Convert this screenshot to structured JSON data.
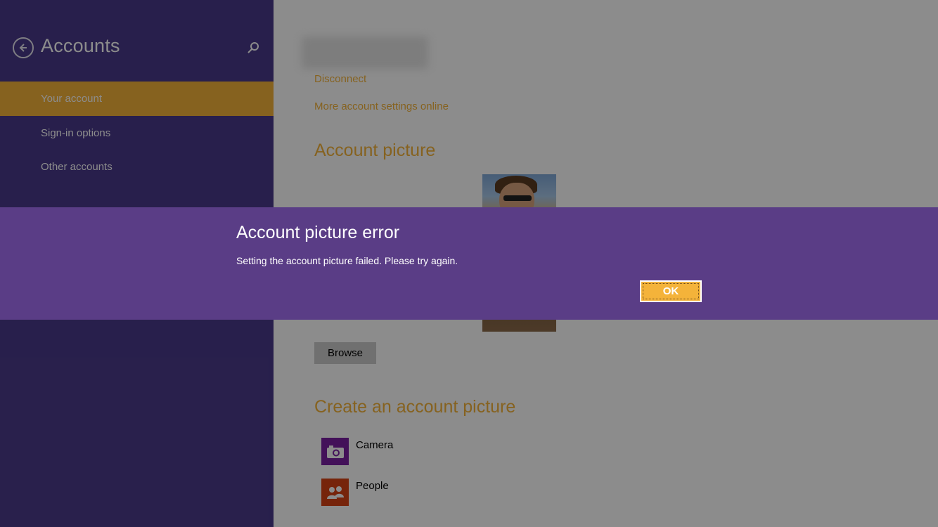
{
  "sidebar": {
    "title": "Accounts",
    "back_icon": "back-arrow-icon",
    "search_icon": "search-icon",
    "items": [
      {
        "label": "Your account",
        "active": true
      },
      {
        "label": "Sign-in options",
        "active": false
      },
      {
        "label": "Other accounts",
        "active": false
      }
    ]
  },
  "content": {
    "disconnect_link": "Disconnect",
    "more_settings_link": "More account settings online",
    "account_picture_title": "Account picture",
    "browse_label": "Browse",
    "create_title": "Create an account picture",
    "create_items": [
      {
        "label": "Camera",
        "icon": "camera-icon",
        "color": "#7b1fa2"
      },
      {
        "label": "People",
        "icon": "people-icon",
        "color": "#d84315"
      }
    ]
  },
  "dialog": {
    "title": "Account picture error",
    "message": "Setting the account picture failed. Please try again.",
    "ok_label": "OK"
  },
  "colors": {
    "accent": "#f4b33a",
    "sidebar_bg": "#4a3a8a",
    "dialog_bg": "#5a3d86"
  }
}
